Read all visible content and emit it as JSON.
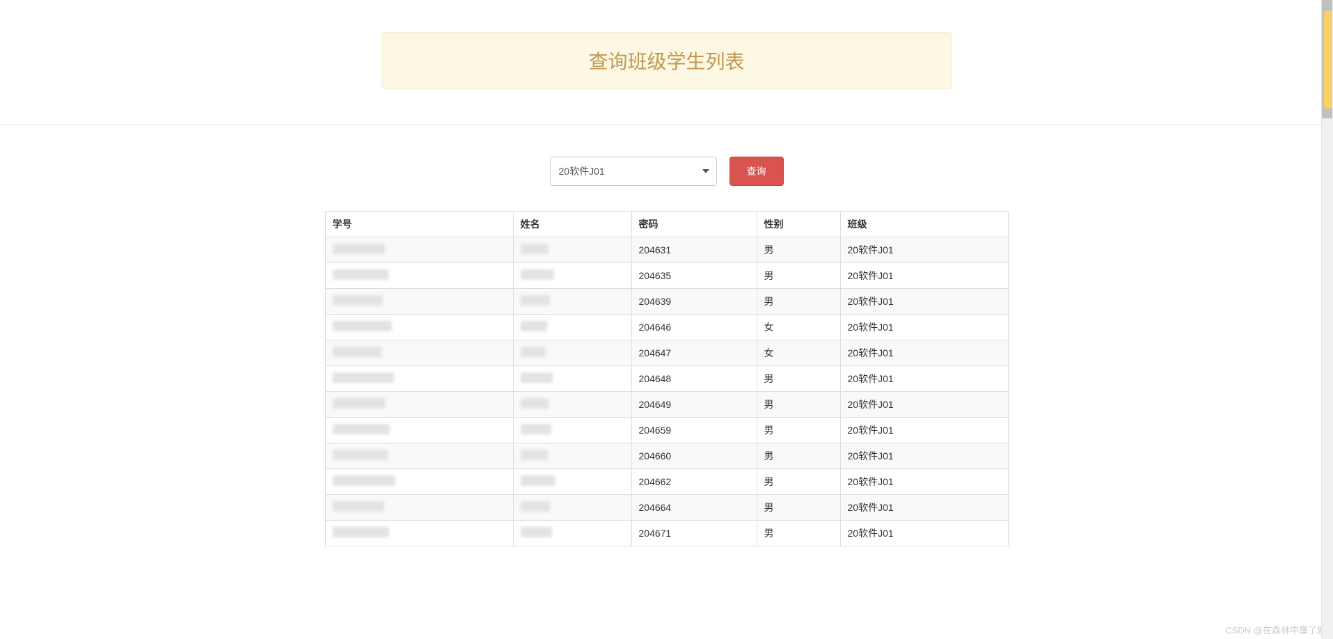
{
  "header": {
    "title": "查询班级学生列表"
  },
  "search": {
    "selected_class": "20软件J01",
    "button_label": "查询"
  },
  "table": {
    "columns": {
      "student_id": "学号",
      "name": "姓名",
      "password": "密码",
      "gender": "性别",
      "class": "班级"
    },
    "rows": [
      {
        "password": "204631",
        "gender": "男",
        "class": "20软件J01"
      },
      {
        "password": "204635",
        "gender": "男",
        "class": "20软件J01"
      },
      {
        "password": "204639",
        "gender": "男",
        "class": "20软件J01"
      },
      {
        "password": "204646",
        "gender": "女",
        "class": "20软件J01"
      },
      {
        "password": "204647",
        "gender": "女",
        "class": "20软件J01"
      },
      {
        "password": "204648",
        "gender": "男",
        "class": "20软件J01"
      },
      {
        "password": "204649",
        "gender": "男",
        "class": "20软件J01"
      },
      {
        "password": "204659",
        "gender": "男",
        "class": "20软件J01"
      },
      {
        "password": "204660",
        "gender": "男",
        "class": "20软件J01"
      },
      {
        "password": "204662",
        "gender": "男",
        "class": "20软件J01"
      },
      {
        "password": "204664",
        "gender": "男",
        "class": "20软件J01"
      },
      {
        "password": "204671",
        "gender": "男",
        "class": "20软件J01"
      }
    ]
  },
  "watermark": "CSDN @在森林中麋了鹿"
}
